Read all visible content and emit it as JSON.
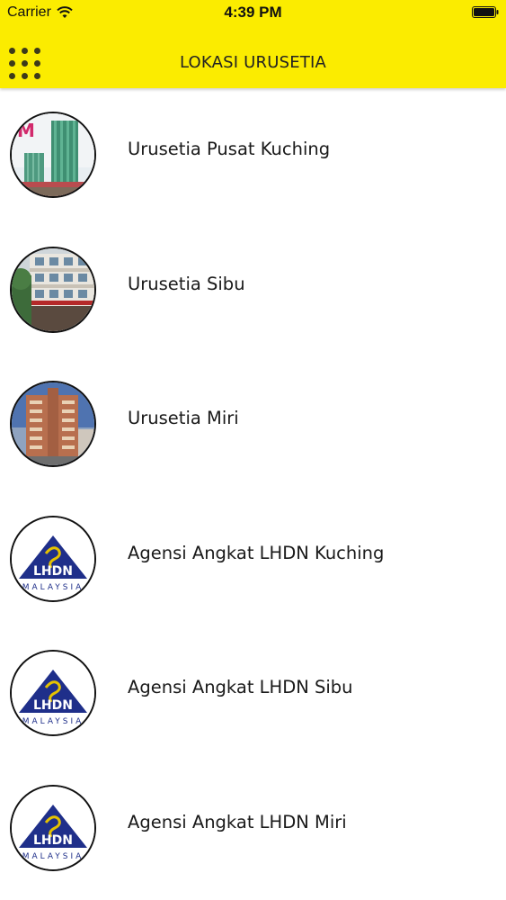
{
  "status_bar": {
    "carrier": "Carrier",
    "wifi_icon": "wifi-icon",
    "time": "4:39 PM",
    "battery_icon": "battery-icon"
  },
  "header": {
    "menu_icon": "grid-menu-icon",
    "title": "LOKASI URUSETIA",
    "background_color": "#fbec00"
  },
  "locations": [
    {
      "label": "Urusetia Pusat Kuching",
      "image": "building-photo-kuching"
    },
    {
      "label": "Urusetia Sibu",
      "image": "building-photo-sibu"
    },
    {
      "label": "Urusetia Miri",
      "image": "building-photo-miri"
    },
    {
      "label": "Agensi Angkat LHDN Kuching",
      "image": "lhdn-logo"
    },
    {
      "label": "Agensi Angkat LHDN Sibu",
      "image": "lhdn-logo"
    },
    {
      "label": "Agensi Angkat LHDN Miri",
      "image": "lhdn-logo"
    }
  ],
  "logo_text": {
    "lhdn": "LHDN",
    "malaysia": "MALAYSIA"
  }
}
